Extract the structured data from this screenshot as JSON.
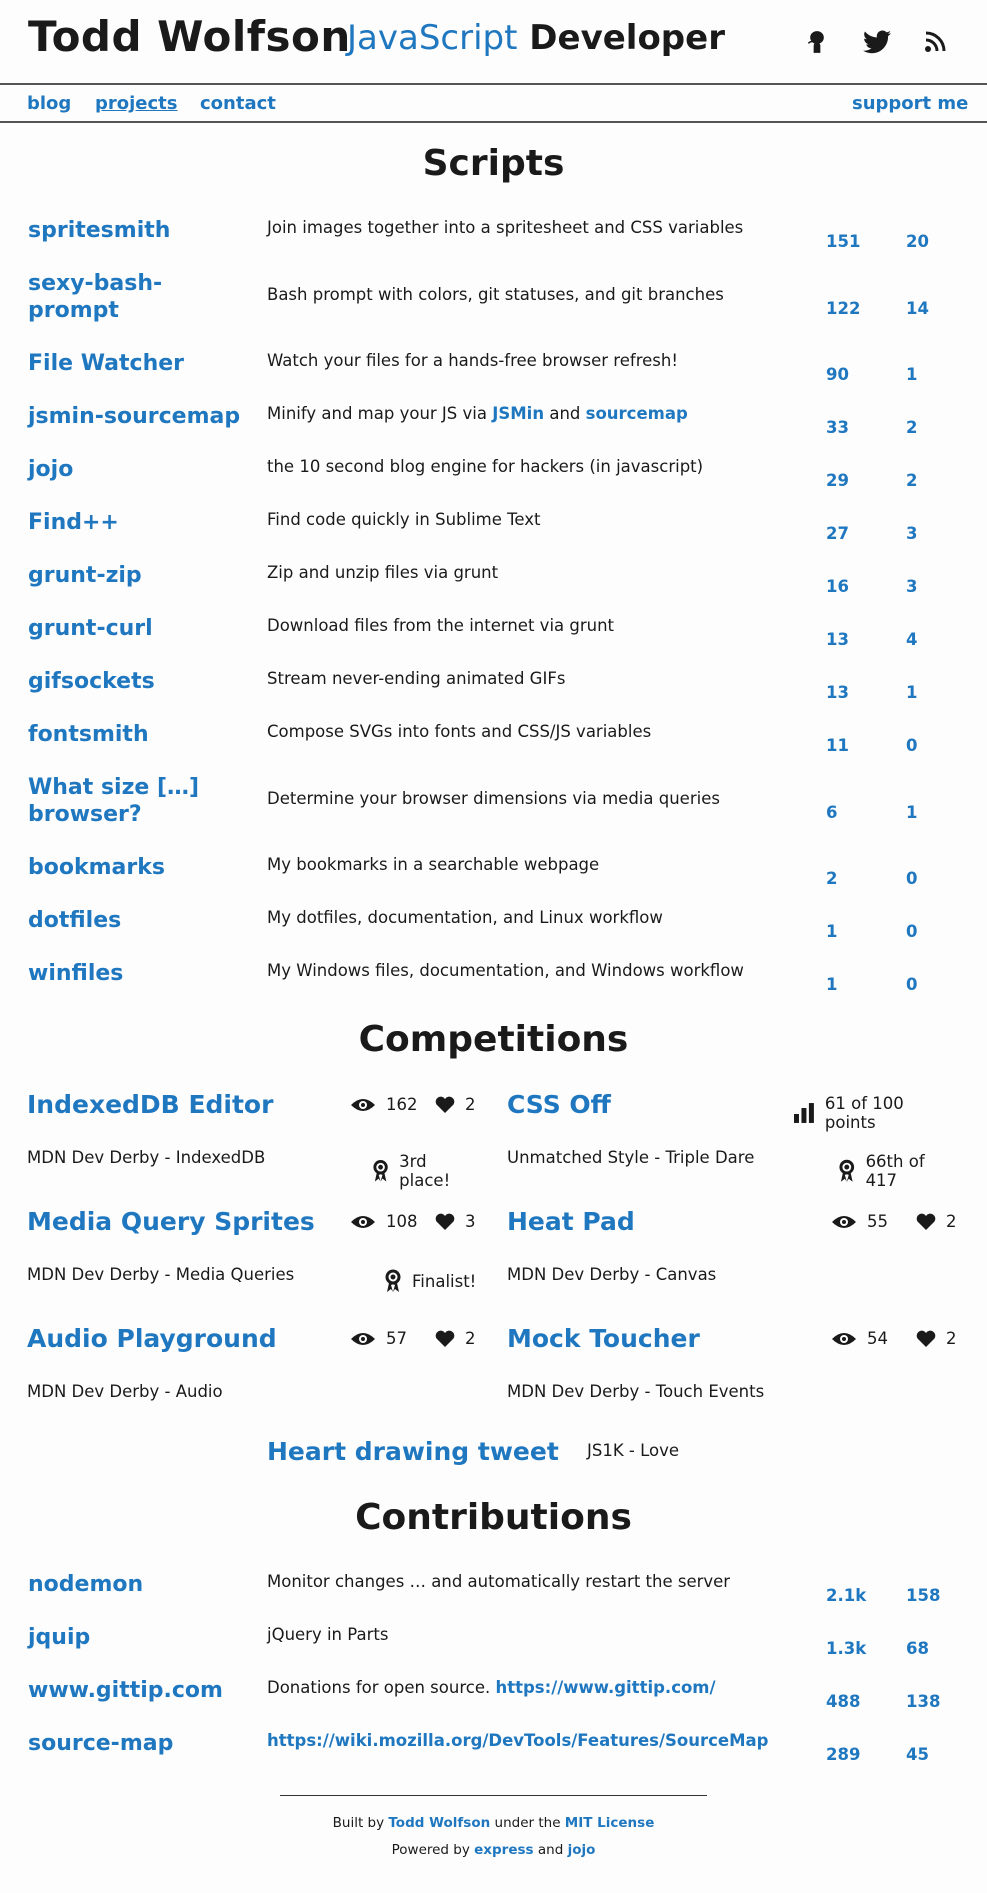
{
  "header": {
    "site_name": "Todd Wolfson",
    "tagline_accent": "JavaScript",
    "tagline_rest": "Developer"
  },
  "nav": {
    "blog": "blog",
    "projects": "projects",
    "contact": "contact",
    "support": "support me"
  },
  "scripts": {
    "heading": "Scripts",
    "items": [
      {
        "name": "spritesmith",
        "desc": "Join images together into a spritesheet and CSS variables",
        "stars": "151",
        "forks": "20"
      },
      {
        "name": "sexy-bash-prompt",
        "desc": "Bash prompt with colors, git statuses, and git branches",
        "stars": "122",
        "forks": "14"
      },
      {
        "name": "File Watcher",
        "desc": "Watch your files for a hands-free browser refresh!",
        "stars": "90",
        "forks": "1"
      },
      {
        "name": "jsmin-sourcemap",
        "desc_pre": "Minify and map your JS via",
        "desc_link1": "JSMin",
        "desc_and": "and",
        "desc_link2": "sourcemap",
        "stars": "33",
        "forks": "2"
      },
      {
        "name": "jojo",
        "desc": "the 10 second blog engine for hackers (in javascript)",
        "stars": "29",
        "forks": "2"
      },
      {
        "name": "Find++",
        "desc": "Find code quickly in Sublime Text",
        "stars": "27",
        "forks": "3"
      },
      {
        "name": "grunt-zip",
        "desc": "Zip and unzip files via grunt",
        "stars": "16",
        "forks": "3"
      },
      {
        "name": "grunt-curl",
        "desc": "Download files from the internet via grunt",
        "stars": "13",
        "forks": "4"
      },
      {
        "name": "gifsockets",
        "desc": "Stream never-ending animated GIFs",
        "stars": "13",
        "forks": "1"
      },
      {
        "name": "fontsmith",
        "desc": "Compose SVGs into fonts and CSS/JS variables",
        "stars": "11",
        "forks": "0"
      },
      {
        "name": "What size […] browser?",
        "desc": "Determine your browser dimensions via media queries",
        "stars": "6",
        "forks": "1"
      },
      {
        "name": "bookmarks",
        "desc": "My bookmarks in a searchable webpage",
        "stars": "2",
        "forks": "0"
      },
      {
        "name": "dotfiles",
        "desc": "My dotfiles, documentation, and Linux workflow",
        "stars": "1",
        "forks": "0"
      },
      {
        "name": "winfiles",
        "desc": "My Windows files, documentation, and Windows workflow",
        "stars": "1",
        "forks": "0"
      }
    ]
  },
  "competitions": {
    "heading": "Competitions",
    "items": [
      {
        "title": "IndexedDB Editor",
        "views": "162",
        "likes": "2",
        "sub": "MDN Dev Derby - IndexedDB",
        "award": "3rd place!"
      },
      {
        "title": "CSS Off",
        "points": "61 of 100 points",
        "sub": "Unmatched Style - Triple Dare",
        "award": "66th of 417"
      },
      {
        "title": "Media Query Sprites",
        "views": "108",
        "likes": "3",
        "sub": "MDN Dev Derby - Media Queries",
        "award": "Finalist!"
      },
      {
        "title": "Heat Pad",
        "views": "55",
        "likes": "2",
        "sub": "MDN Dev Derby - Canvas"
      },
      {
        "title": "Audio Playground",
        "views": "57",
        "likes": "2",
        "sub": "MDN Dev Derby - Audio"
      },
      {
        "title": "Mock Toucher",
        "views": "54",
        "likes": "2",
        "sub": "MDN Dev Derby - Touch Events"
      }
    ],
    "tweet": {
      "title": "Heart drawing tweet",
      "sub": "JS1K - Love"
    }
  },
  "contributions": {
    "heading": "Contributions",
    "items": [
      {
        "name": "nodemon",
        "desc": "Monitor changes … and automatically restart the server",
        "stars": "2.1k",
        "forks": "158"
      },
      {
        "name": "jquip",
        "desc": "jQuery in Parts",
        "stars": "1.3k",
        "forks": "68"
      },
      {
        "name": "www.gittip.com",
        "desc": "Donations for open source.",
        "desc_link": "https://www.gittip.com/",
        "stars": "488",
        "forks": "138"
      },
      {
        "name": "source-map",
        "desc_link": "https://wiki.mozilla.org/DevTools/Features/SourceMap",
        "stars": "289",
        "forks": "45"
      }
    ]
  },
  "footer": {
    "built_by": "Built by",
    "author": "Todd Wolfson",
    "under": "under the",
    "license": "MIT License",
    "powered": "Powered by",
    "express": "express",
    "and": "and",
    "jojo": "jojo"
  },
  "icons": {
    "github": "github-icon",
    "twitter": "twitter-icon",
    "rss": "rss-icon",
    "views": "eye-icon",
    "likes": "heart-icon",
    "award": "award-ribbon-icon",
    "points": "bar-chart-icon"
  },
  "colors": {
    "link": "#1f77c0",
    "text": "#1a1a1a",
    "background": "#fdfdfd"
  }
}
